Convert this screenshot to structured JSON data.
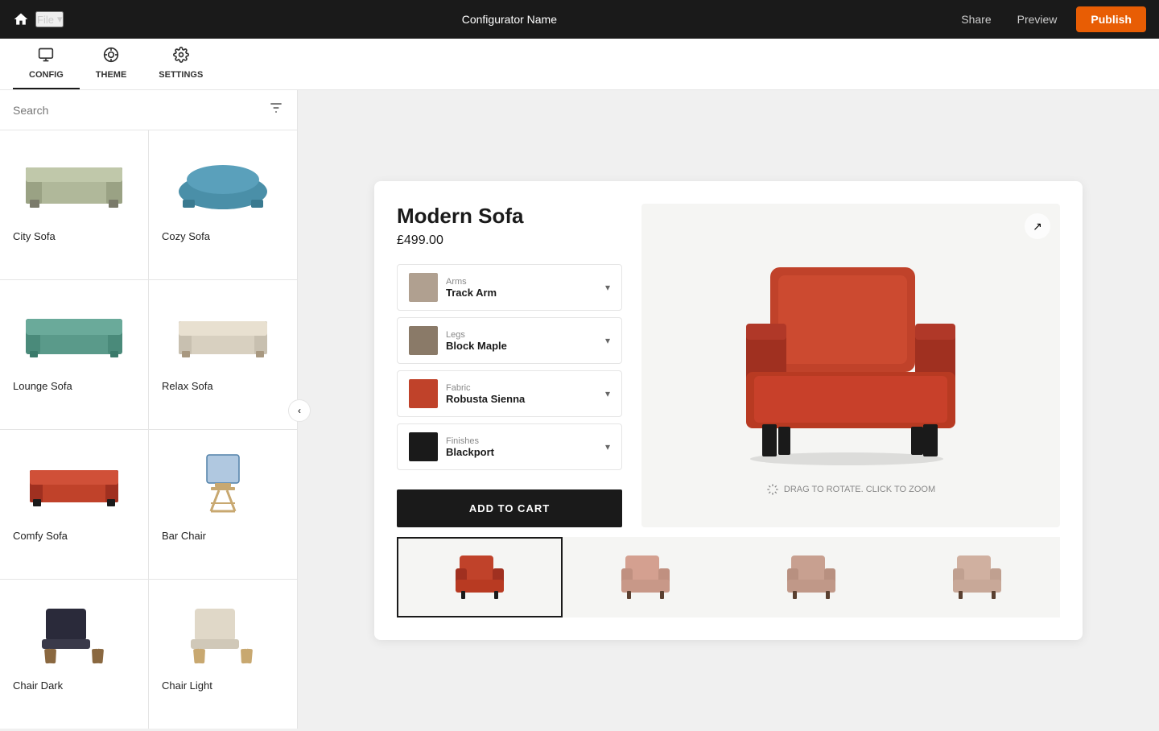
{
  "topnav": {
    "home_label": "⌂",
    "file_label": "File",
    "file_caret": "▾",
    "title": "Configurator Name",
    "share_label": "Share",
    "preview_label": "Preview",
    "publish_label": "Publish"
  },
  "tabs": [
    {
      "id": "config",
      "icon": "🖥",
      "label": "CONFIG",
      "active": true
    },
    {
      "id": "theme",
      "icon": "🎨",
      "label": "THEME",
      "active": false
    },
    {
      "id": "settings",
      "icon": "⚙",
      "label": "SETTINGS",
      "active": false
    }
  ],
  "sidebar": {
    "search_placeholder": "Search",
    "products": [
      {
        "id": "city-sofa",
        "name": "City Sofa",
        "color": "#b0b89a",
        "type": "sofa-wide"
      },
      {
        "id": "cozy-sofa",
        "name": "Cozy Sofa",
        "color": "#4a8fa8",
        "type": "sofa-round"
      },
      {
        "id": "lounge-sofa",
        "name": "Lounge Sofa",
        "color": "#5a9a8a",
        "type": "sofa-long"
      },
      {
        "id": "relax-sofa",
        "name": "Relax Sofa",
        "color": "#d8d0c0",
        "type": "sofa-long"
      },
      {
        "id": "comfy-sofa",
        "name": "Comfy Sofa",
        "color": "#c0422a",
        "type": "sofa-compact"
      },
      {
        "id": "bar-chair",
        "name": "Bar Chair",
        "color": "#c8a870",
        "type": "bar-chair"
      },
      {
        "id": "chair-dark",
        "name": "Chair Dark",
        "color": "#2a2a3a",
        "type": "lounge-chair"
      },
      {
        "id": "chair-light",
        "name": "Chair Light",
        "color": "#e0d8c8",
        "type": "lounge-chair"
      }
    ]
  },
  "product": {
    "name": "Modern Sofa",
    "price": "£499.00",
    "options": [
      {
        "id": "arms",
        "label": "Arms",
        "value": "Track Arm",
        "swatch_color": "#b0a090"
      },
      {
        "id": "legs",
        "label": "Legs",
        "value": "Block Maple",
        "swatch_color": "#8a7a68"
      },
      {
        "id": "fabric",
        "label": "Fabric",
        "value": "Robusta Sienna",
        "swatch_color": "#c0422a"
      },
      {
        "id": "finishes",
        "label": "Finishes",
        "value": "Blackport",
        "swatch_color": "#1a1a1a"
      }
    ],
    "add_to_cart_label": "ADD TO CART",
    "drag_hint": "DRAG TO ROTATE. CLICK TO ZOOM",
    "thumbnails": [
      {
        "id": "thumb1",
        "color": "#c0422a",
        "active": true
      },
      {
        "id": "thumb2",
        "color": "#d4a090",
        "active": false
      },
      {
        "id": "thumb3",
        "color": "#c8a090",
        "active": false
      },
      {
        "id": "thumb4",
        "color": "#d0b0a0",
        "active": false
      }
    ]
  },
  "icons": {
    "filter": "⚙",
    "chevron_down": "▾",
    "chevron_left": "‹",
    "expand": "↗",
    "drag": "↺"
  }
}
